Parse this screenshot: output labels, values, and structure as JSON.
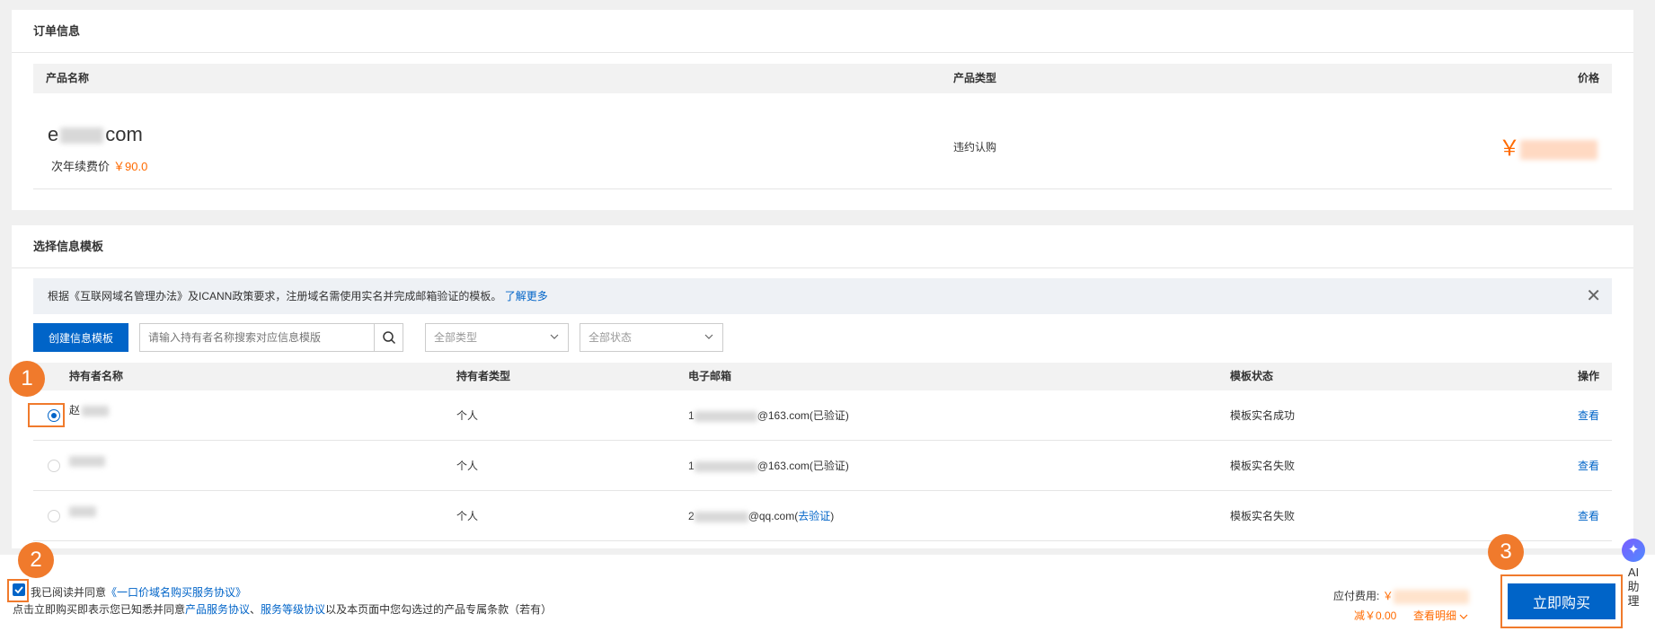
{
  "order": {
    "title": "订单信息",
    "headers": {
      "name": "产品名称",
      "type": "产品类型",
      "price": "价格"
    },
    "domain_prefix": "e",
    "domain_suffix": "com",
    "renew_label": "次年续费价",
    "renew_price": "￥90.0",
    "product_type": "违约认购",
    "price_symbol": "￥"
  },
  "template": {
    "title": "选择信息模板",
    "notice_text": "根据《互联网域名管理办法》及ICANN政策要求，注册域名需使用实名并完成邮箱验证的模板。",
    "notice_link": "了解更多",
    "create_button": "创建信息模板",
    "search_placeholder": "请输入持有者名称搜索对应信息模版",
    "type_select": "全部类型",
    "status_select": "全部状态",
    "headers": {
      "holder": "持有者名称",
      "holder_type": "持有者类型",
      "email": "电子邮箱",
      "status": "模板状态",
      "action": "操作"
    },
    "rows": [
      {
        "holder": "赵",
        "holder_type": "个人",
        "email_prefix": "1",
        "email_domain": "@163.com",
        "email_state": "(已验证)",
        "email_state_link": "",
        "status": "模板实名成功",
        "action": "查看",
        "selected": true
      },
      {
        "holder": "",
        "holder_type": "个人",
        "email_prefix": "1",
        "email_domain": "@163.com",
        "email_state": "(已验证)",
        "email_state_link": "",
        "status": "模板实名失败",
        "action": "查看",
        "selected": false
      },
      {
        "holder": "",
        "holder_type": "个人",
        "email_prefix": "2",
        "email_domain": "@qq.com(",
        "email_state": ")",
        "email_state_link": "去验证",
        "status": "模板实名失败",
        "action": "查看",
        "selected": false
      }
    ]
  },
  "footer": {
    "agree_text": "我已阅读并同意",
    "agree_link": "《一口价域名购买服务协议》",
    "notice_pre": "点击立即购买即表示您已知悉并同意",
    "notice_link1": "产品服务协议",
    "notice_sep": "、",
    "notice_link2": "服务等级协议",
    "notice_post": "以及本页面中您勾选过的产品专属条款（若有）",
    "fee_label": "应付费用:",
    "fee_symbol": "￥",
    "discount": "减￥0.00",
    "detail_link": "查看明细",
    "buy_button": "立即购买"
  },
  "annotations": [
    "1",
    "2",
    "3"
  ],
  "assistant": {
    "label1": "AI",
    "label2": "助",
    "label3": "理"
  }
}
